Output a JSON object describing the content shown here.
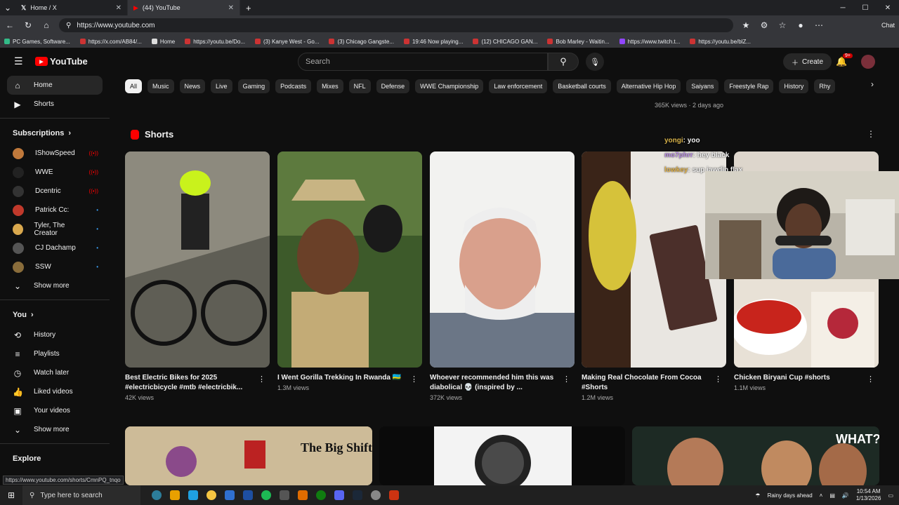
{
  "browser": {
    "tabs": [
      {
        "title": "Home / X",
        "icon": "x-logo"
      },
      {
        "title": "(44) YouTube",
        "icon": "youtube-logo"
      }
    ],
    "new_tab": "+",
    "url": "https://www.youtube.com",
    "profile_label": "Chat",
    "bookmarks": [
      "PC Games, Software...",
      "https://x.com/AB84/...",
      "Home",
      "https://youtu.be/Do...",
      "(3) Kanye West - Go...",
      "(3) Chicago Gangste...",
      "19:46 Now playing...",
      "(12) CHICAGO GAN...",
      "Bob Marley - Waitin...",
      "https://www.twitch.t...",
      "https://youtu.be/blZ..."
    ],
    "status_url": "https://www.youtube.com/shorts/CmnPQ_tnqo"
  },
  "header": {
    "logo": "YouTube",
    "search_placeholder": "Search",
    "create_label": "Create",
    "notifications": "9+"
  },
  "sidebar": {
    "top": [
      {
        "label": "Home",
        "icon": "home-icon"
      },
      {
        "label": "Shorts",
        "icon": "shorts-icon"
      }
    ],
    "subscriptions_label": "Subscriptions",
    "subscriptions": [
      {
        "label": "IShowSpeed",
        "color": "#c0793b",
        "live": true
      },
      {
        "label": "WWE",
        "color": "#222",
        "live": true
      },
      {
        "label": "Dcentric",
        "color": "#333",
        "live": true
      },
      {
        "label": "Patrick Cc:",
        "color": "#c0392b",
        "live": false
      },
      {
        "label": "Tyler, The Creator",
        "color": "#d9a84e",
        "live": false
      },
      {
        "label": "CJ Dachamp",
        "color": "#555",
        "live": false
      },
      {
        "label": "SSW",
        "color": "#8a6d3b",
        "live": false
      }
    ],
    "show_more": "Show more",
    "you_label": "You",
    "you_items": [
      {
        "label": "History",
        "icon": "history-icon"
      },
      {
        "label": "Playlists",
        "icon": "playlists-icon"
      },
      {
        "label": "Watch later",
        "icon": "clock-icon"
      },
      {
        "label": "Liked videos",
        "icon": "thumbs-up-icon"
      },
      {
        "label": "Your videos",
        "icon": "video-icon"
      },
      {
        "label": "Show more",
        "icon": "chevron-down-icon"
      }
    ],
    "explore_label": "Explore"
  },
  "chips": [
    "All",
    "Music",
    "News",
    "Live",
    "Gaming",
    "Podcasts",
    "Mixes",
    "NFL",
    "Defense",
    "WWE Championship",
    "Law enforcement",
    "Basketball courts",
    "Alternative Hip Hop",
    "Saiyans",
    "Freestyle Rap",
    "History",
    "Rhy"
  ],
  "top_meta": "365K views · 2 days ago",
  "shorts": {
    "heading": "Shorts",
    "items": [
      {
        "title": "Best Electric Bikes for 2025 #electricbicycle  #mtb  #electricbik...",
        "views": "42K views",
        "bg": "#6b6a5f"
      },
      {
        "title": "I Went Gorilla Trekking In Rwanda 🇷🇼",
        "views": "1.3M views",
        "bg": "#3f5a2a"
      },
      {
        "title": "Whoever recommended him this was diabolical 💀 (inspired by ...",
        "views": "372K views",
        "bg": "#8a8f96"
      },
      {
        "title": "Making Real Chocolate From Cocoa #Shorts",
        "views": "1.2M views",
        "bg": "#d8d4cf"
      },
      {
        "title": "Chicken Biryani Cup #shorts",
        "views": "1.1M views",
        "bg": "#e6e0d8"
      }
    ]
  },
  "chat": [
    {
      "user": "yongi",
      "msg": "yoo",
      "color": "#d7b24a"
    },
    {
      "user": "mo7phrr",
      "msg": "hey black",
      "color": "#b68be0"
    },
    {
      "user": "lowkey",
      "msg": "sup jawdin flax",
      "color": "#e0b14a"
    }
  ],
  "row2_overlay": "WHAT?",
  "row2_text": "The Big Shift",
  "taskbar": {
    "search": "Type here to search",
    "weather": "Rainy days ahead",
    "time": "10:54 AM",
    "date": "1/13/2026"
  }
}
